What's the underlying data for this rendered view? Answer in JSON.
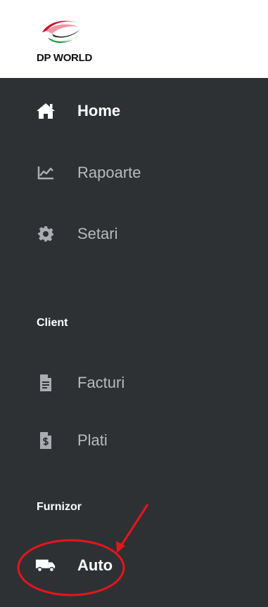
{
  "brand": {
    "logo_text": "DP WORLD"
  },
  "sidebar": {
    "items": [
      {
        "label": "Home",
        "icon": "home-icon",
        "active": true
      },
      {
        "label": "Rapoarte",
        "icon": "chart-icon",
        "active": false
      },
      {
        "label": "Setari",
        "icon": "gear-icon",
        "active": false
      }
    ],
    "sections": [
      {
        "title": "Client",
        "items": [
          {
            "label": "Facturi",
            "icon": "invoice-icon"
          },
          {
            "label": "Plati",
            "icon": "payment-doc-icon"
          }
        ]
      },
      {
        "title": "Furnizor",
        "items": [
          {
            "label": "Auto",
            "icon": "truck-icon",
            "highlighted": true
          }
        ]
      }
    ]
  },
  "colors": {
    "sidebar_bg": "#2e3133",
    "active_text": "#ffffff",
    "inactive_text": "#b8bbbe",
    "annotation": "#e8141c",
    "logo_red": "#d0102a",
    "logo_green": "#1e8a3c"
  }
}
